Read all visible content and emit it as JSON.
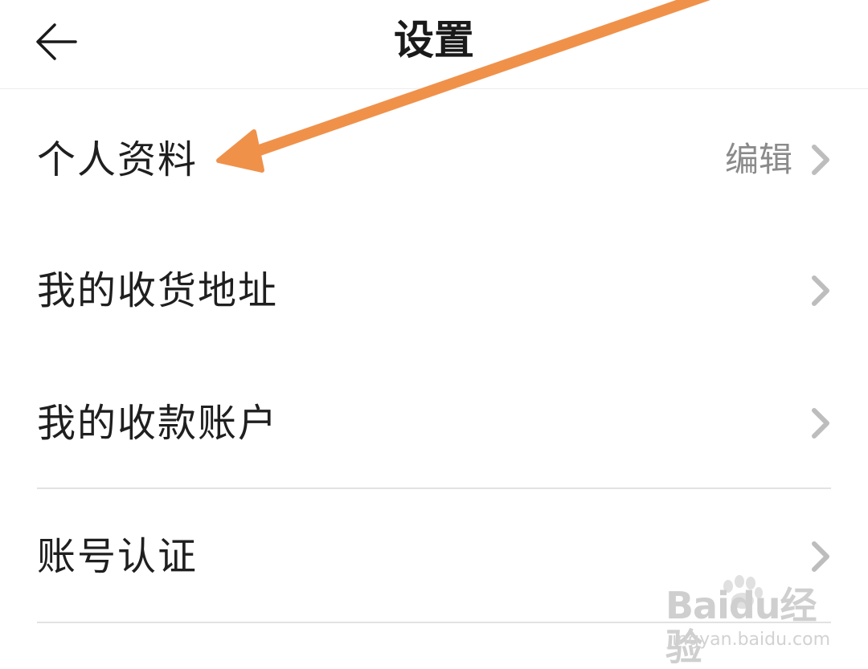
{
  "header": {
    "title": "设置",
    "back_icon": "arrow-left-icon"
  },
  "rows": [
    {
      "label": "个人资料",
      "value": "编辑",
      "icon": "chevron-right-icon"
    },
    {
      "label": "我的收货地址",
      "value": "",
      "icon": "chevron-right-icon"
    },
    {
      "label": "我的收款账户",
      "value": "",
      "icon": "chevron-right-icon"
    },
    {
      "label": "账号认证",
      "value": "",
      "icon": "chevron-right-icon"
    }
  ],
  "annotation": {
    "arrow_color": "#F0914A",
    "points_to": "个人资料"
  },
  "watermark": {
    "logo": "Baidu经验",
    "url": "jingyan.baidu.com"
  },
  "colors": {
    "title": "#1a1a1a",
    "label": "#1f1f1f",
    "value": "#8a8a8a",
    "chevron": "#bdbdbd",
    "divider": "#e2e2e2"
  }
}
